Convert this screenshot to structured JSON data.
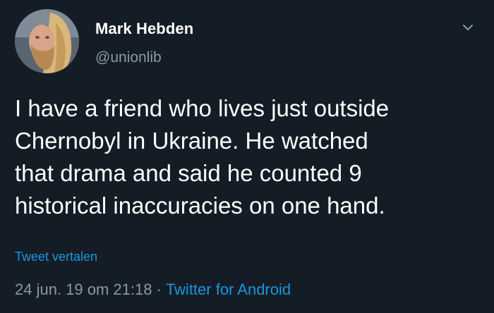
{
  "author": {
    "name": "Mark Hebden",
    "handle": "@unionlib",
    "avatar_icon": "profile-avatar"
  },
  "tweet": {
    "text": "I have a friend who lives just outside\nChernobyl in Ukraine. He watched\nthat drama and said he counted 9\nhistorical inaccuracies on one hand.",
    "translate_label": "Tweet vertalen",
    "timestamp": "24 jun. 19 om 21:18",
    "separator": "·",
    "source": "Twitter for Android"
  },
  "icons": {
    "menu": "chevron-down-icon"
  },
  "colors": {
    "background": "#141d26",
    "primary_text": "#ffffff",
    "secondary_text": "#8899a6",
    "link": "#1b95e0"
  }
}
